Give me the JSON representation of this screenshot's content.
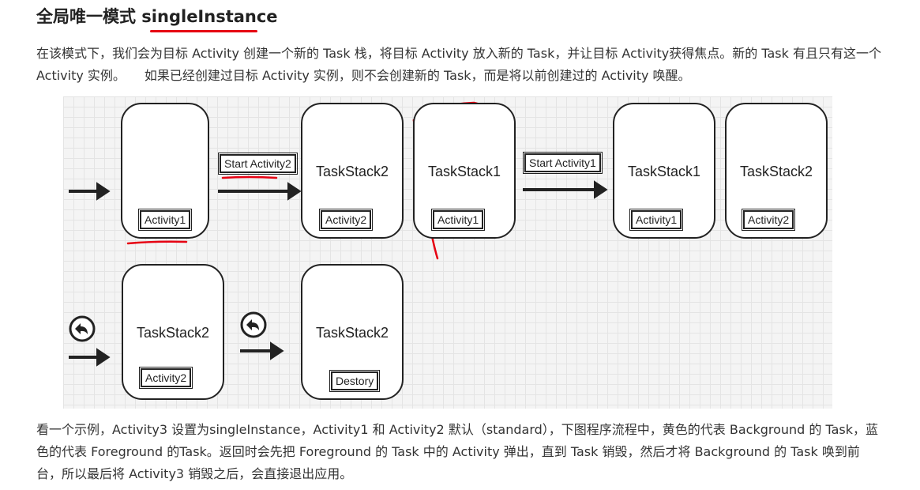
{
  "heading": "全局唯一模式 singleInstance",
  "paragraph1": "在该模式下，我们会为目标 Activity 创建一个新的 Task 栈，将目标 Activity 放入新的 Task，并让目标 Activity获得焦点。新的 Task 有且只有这一个 Activity 实例。　　如果已经创建过目标 Activity 实例，则不会创建新的 Task，而是将以前创建过的 Activity 唤醒。",
  "diagram": {
    "start_step_1": "Start Activity2",
    "start_step_2": "Start Activity1",
    "stacks": [
      {
        "title": "",
        "activity": "Activity1"
      },
      {
        "title": "TaskStack2",
        "activity": "Activity2"
      },
      {
        "title": "TaskStack1",
        "activity": "Activity1"
      },
      {
        "title": "TaskStack1",
        "activity": "Activity1"
      },
      {
        "title": "TaskStack2",
        "activity": "Activity2"
      },
      {
        "title": "TaskStack2",
        "activity": "Activity2"
      },
      {
        "title": "TaskStack2",
        "activity": "Destory"
      }
    ],
    "icons": {
      "arrow": "right-arrow-icon",
      "back": "back-circle-icon"
    },
    "colors": {
      "annotation": "#e60012",
      "outline": "#222222"
    }
  },
  "paragraph2": "看一个示例，Activity3 设置为singleInstance，Activity1 和 Activity2 默认（standard），下图程序流程中，黄色的代表 Background 的 Task，蓝色的代表 Foreground 的Task。返回时会先把 Foreground 的 Task 中的 Activity 弹出，直到 Task 销毁，然后才将 Background 的 Task 唤到前台，所以最后将 Activity3 销毁之后，会直接退出应用。"
}
